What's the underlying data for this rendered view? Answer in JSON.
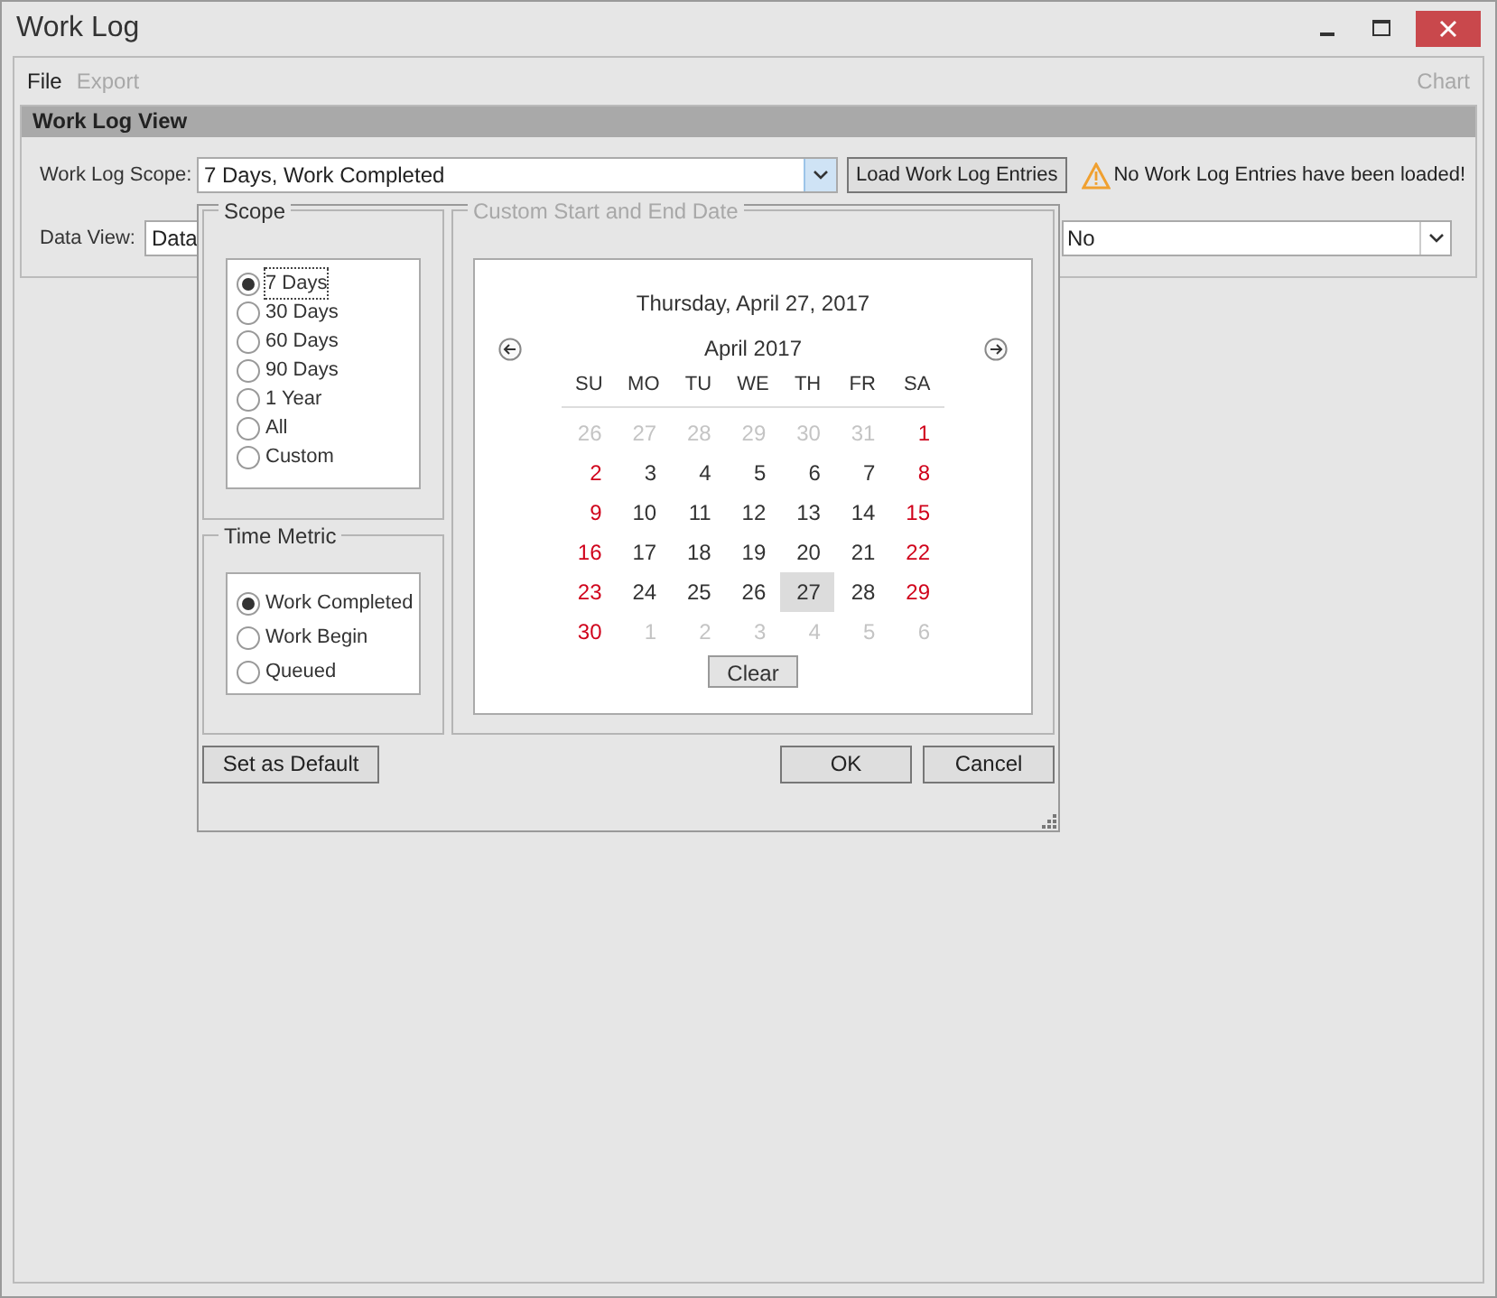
{
  "window": {
    "title": "Work Log"
  },
  "menu": [
    {
      "label": "File",
      "disabled": false
    },
    {
      "label": "Export",
      "disabled": true
    }
  ],
  "menu_right": [
    {
      "label": "Chart",
      "disabled": true
    }
  ],
  "panel": {
    "title": "Work Log View",
    "scope_label": "Work Log Scope:",
    "scope_value": "7 Days, Work Completed",
    "load_button": "Load Work Log Entries",
    "warning": "No Work Log Entries have been loaded!",
    "data_view_label": "Data View:",
    "data_view_value": "Data",
    "second_field_value": "No"
  },
  "popup": {
    "scope": {
      "title": "Scope",
      "options": [
        {
          "label": "7 Days",
          "selected": true
        },
        {
          "label": "30 Days",
          "selected": false
        },
        {
          "label": "60 Days",
          "selected": false
        },
        {
          "label": "90 Days",
          "selected": false
        },
        {
          "label": "1 Year",
          "selected": false
        },
        {
          "label": "All",
          "selected": false
        },
        {
          "label": "Custom",
          "selected": false
        }
      ]
    },
    "time_metric": {
      "title": "Time Metric",
      "options": [
        {
          "label": "Work Completed",
          "selected": true
        },
        {
          "label": "Work Begin",
          "selected": false
        },
        {
          "label": "Queued",
          "selected": false
        }
      ]
    },
    "custom": {
      "title": "Custom Start and End Date",
      "disabled": true,
      "calendar": {
        "date_heading": "Thursday, April 27, 2017",
        "month": "April 2017",
        "weekdays": [
          "SU",
          "MO",
          "TU",
          "WE",
          "TH",
          "FR",
          "SA"
        ],
        "days": [
          {
            "label": "26",
            "kind": "muted",
            "selected": false
          },
          {
            "label": "27",
            "kind": "muted",
            "selected": false
          },
          {
            "label": "28",
            "kind": "muted",
            "selected": false
          },
          {
            "label": "29",
            "kind": "muted",
            "selected": false
          },
          {
            "label": "30",
            "kind": "muted",
            "selected": false
          },
          {
            "label": "31",
            "kind": "muted",
            "selected": false
          },
          {
            "label": "1",
            "kind": "weekend",
            "selected": false
          },
          {
            "label": "2",
            "kind": "weekend",
            "selected": false
          },
          {
            "label": "3",
            "kind": "normal",
            "selected": false
          },
          {
            "label": "4",
            "kind": "normal",
            "selected": false
          },
          {
            "label": "5",
            "kind": "normal",
            "selected": false
          },
          {
            "label": "6",
            "kind": "normal",
            "selected": false
          },
          {
            "label": "7",
            "kind": "normal",
            "selected": false
          },
          {
            "label": "8",
            "kind": "weekend",
            "selected": false
          },
          {
            "label": "9",
            "kind": "weekend",
            "selected": false
          },
          {
            "label": "10",
            "kind": "normal",
            "selected": false
          },
          {
            "label": "11",
            "kind": "normal",
            "selected": false
          },
          {
            "label": "12",
            "kind": "normal",
            "selected": false
          },
          {
            "label": "13",
            "kind": "normal",
            "selected": false
          },
          {
            "label": "14",
            "kind": "normal",
            "selected": false
          },
          {
            "label": "15",
            "kind": "weekend",
            "selected": false
          },
          {
            "label": "16",
            "kind": "weekend",
            "selected": false
          },
          {
            "label": "17",
            "kind": "normal",
            "selected": false
          },
          {
            "label": "18",
            "kind": "normal",
            "selected": false
          },
          {
            "label": "19",
            "kind": "normal",
            "selected": false
          },
          {
            "label": "20",
            "kind": "normal",
            "selected": false
          },
          {
            "label": "21",
            "kind": "normal",
            "selected": false
          },
          {
            "label": "22",
            "kind": "weekend",
            "selected": false
          },
          {
            "label": "23",
            "kind": "weekend",
            "selected": false
          },
          {
            "label": "24",
            "kind": "normal",
            "selected": false
          },
          {
            "label": "25",
            "kind": "normal",
            "selected": false
          },
          {
            "label": "26",
            "kind": "normal",
            "selected": false
          },
          {
            "label": "27",
            "kind": "normal",
            "selected": true
          },
          {
            "label": "28",
            "kind": "normal",
            "selected": false
          },
          {
            "label": "29",
            "kind": "weekend",
            "selected": false
          },
          {
            "label": "30",
            "kind": "weekend",
            "selected": false
          },
          {
            "label": "1",
            "kind": "muted",
            "selected": false
          },
          {
            "label": "2",
            "kind": "muted",
            "selected": false
          },
          {
            "label": "3",
            "kind": "muted",
            "selected": false
          },
          {
            "label": "4",
            "kind": "muted",
            "selected": false
          },
          {
            "label": "5",
            "kind": "muted",
            "selected": false
          },
          {
            "label": "6",
            "kind": "muted",
            "selected": false
          }
        ],
        "clear_button": "Clear"
      }
    },
    "buttons": {
      "default": "Set as Default",
      "ok": "OK",
      "cancel": "Cancel"
    }
  }
}
